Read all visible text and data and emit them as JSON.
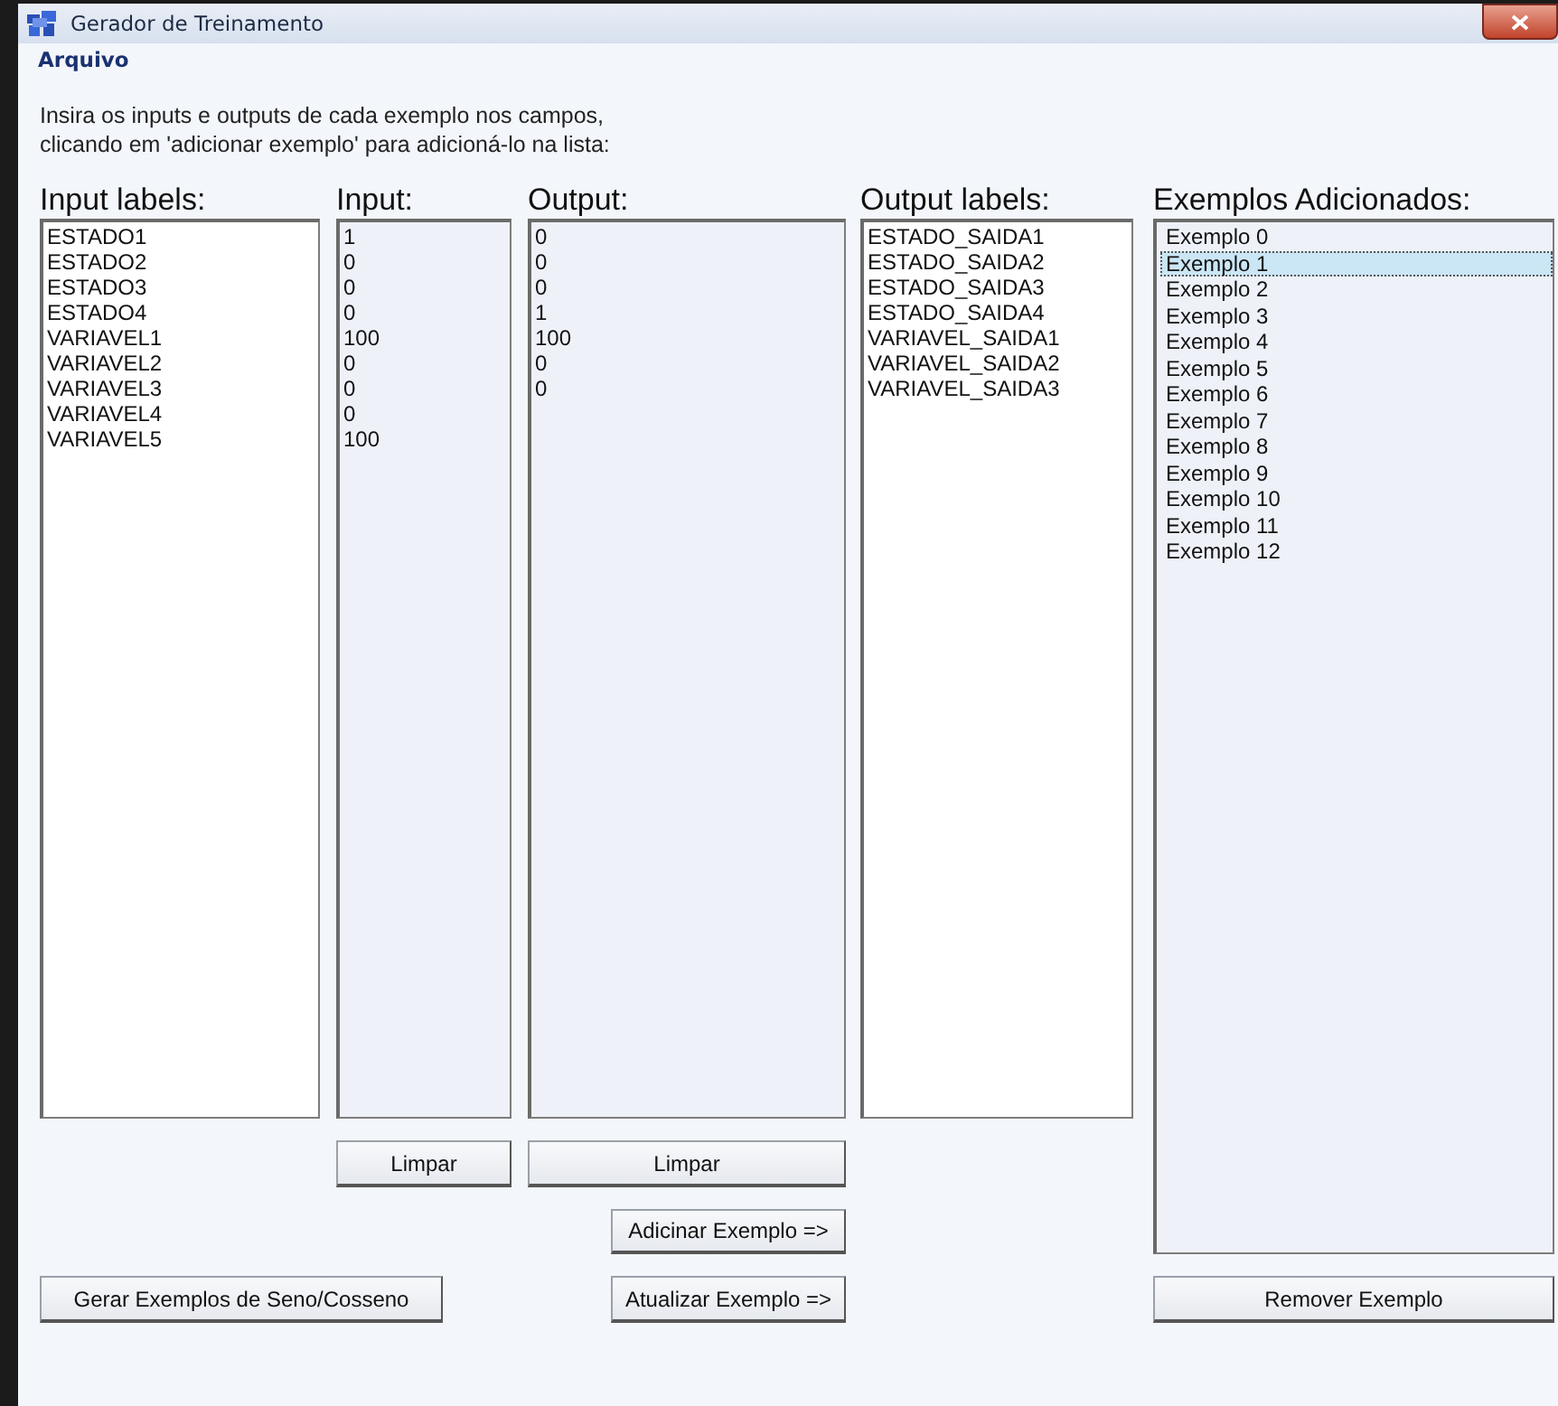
{
  "window": {
    "title": "Gerador de Treinamento"
  },
  "menu": [
    "Arquivo"
  ],
  "instructions": [
    "Insira os inputs e outputs de cada exemplo nos campos,",
    "clicando em 'adicionar exemplo' para adicioná-lo na lista:"
  ],
  "input_labels": {
    "header": "Input labels:",
    "lines": [
      "ESTADO1",
      "ESTADO2",
      "ESTADO3",
      "ESTADO4",
      "VARIAVEL1",
      "VARIAVEL2",
      "VARIAVEL3",
      "VARIAVEL4",
      "VARIAVEL5"
    ]
  },
  "input": {
    "header": "Input:",
    "lines": [
      "1",
      "0",
      "0",
      "0",
      "100",
      "0",
      "0",
      "0",
      "100"
    ]
  },
  "output": {
    "header": "Output:",
    "lines": [
      "0",
      "0",
      "0",
      "1",
      "100",
      "0",
      "0"
    ]
  },
  "output_labels": {
    "header": "Output labels:",
    "lines": [
      "ESTADO_SAIDA1",
      "ESTADO_SAIDA2",
      "ESTADO_SAIDA3",
      "ESTADO_SAIDA4",
      "VARIAVEL_SAIDA1",
      "VARIAVEL_SAIDA2",
      "VARIAVEL_SAIDA3"
    ]
  },
  "examples": {
    "header": "Exemplos Adicionados:",
    "items": [
      {
        "label": "Exemplo 0",
        "selected": false
      },
      {
        "label": "Exemplo 1",
        "selected": true
      },
      {
        "label": "Exemplo 2",
        "selected": false
      },
      {
        "label": "Exemplo 3",
        "selected": false
      },
      {
        "label": "Exemplo 4",
        "selected": false
      },
      {
        "label": "Exemplo 5",
        "selected": false
      },
      {
        "label": "Exemplo 6",
        "selected": false
      },
      {
        "label": "Exemplo 7",
        "selected": false
      },
      {
        "label": "Exemplo 8",
        "selected": false
      },
      {
        "label": "Exemplo 9",
        "selected": false
      },
      {
        "label": "Exemplo 10",
        "selected": false
      },
      {
        "label": "Exemplo 11",
        "selected": false
      },
      {
        "label": "Exemplo 12",
        "selected": false
      }
    ]
  },
  "buttons": {
    "clear_input": "Limpar",
    "clear_output": "Limpar",
    "add_example": "Adicinar Exemplo =>",
    "update_example": "Atualizar Exemplo =>",
    "generate": "Gerar Exemplos de Seno/Cosseno",
    "remove": "Remover Exemplo"
  }
}
